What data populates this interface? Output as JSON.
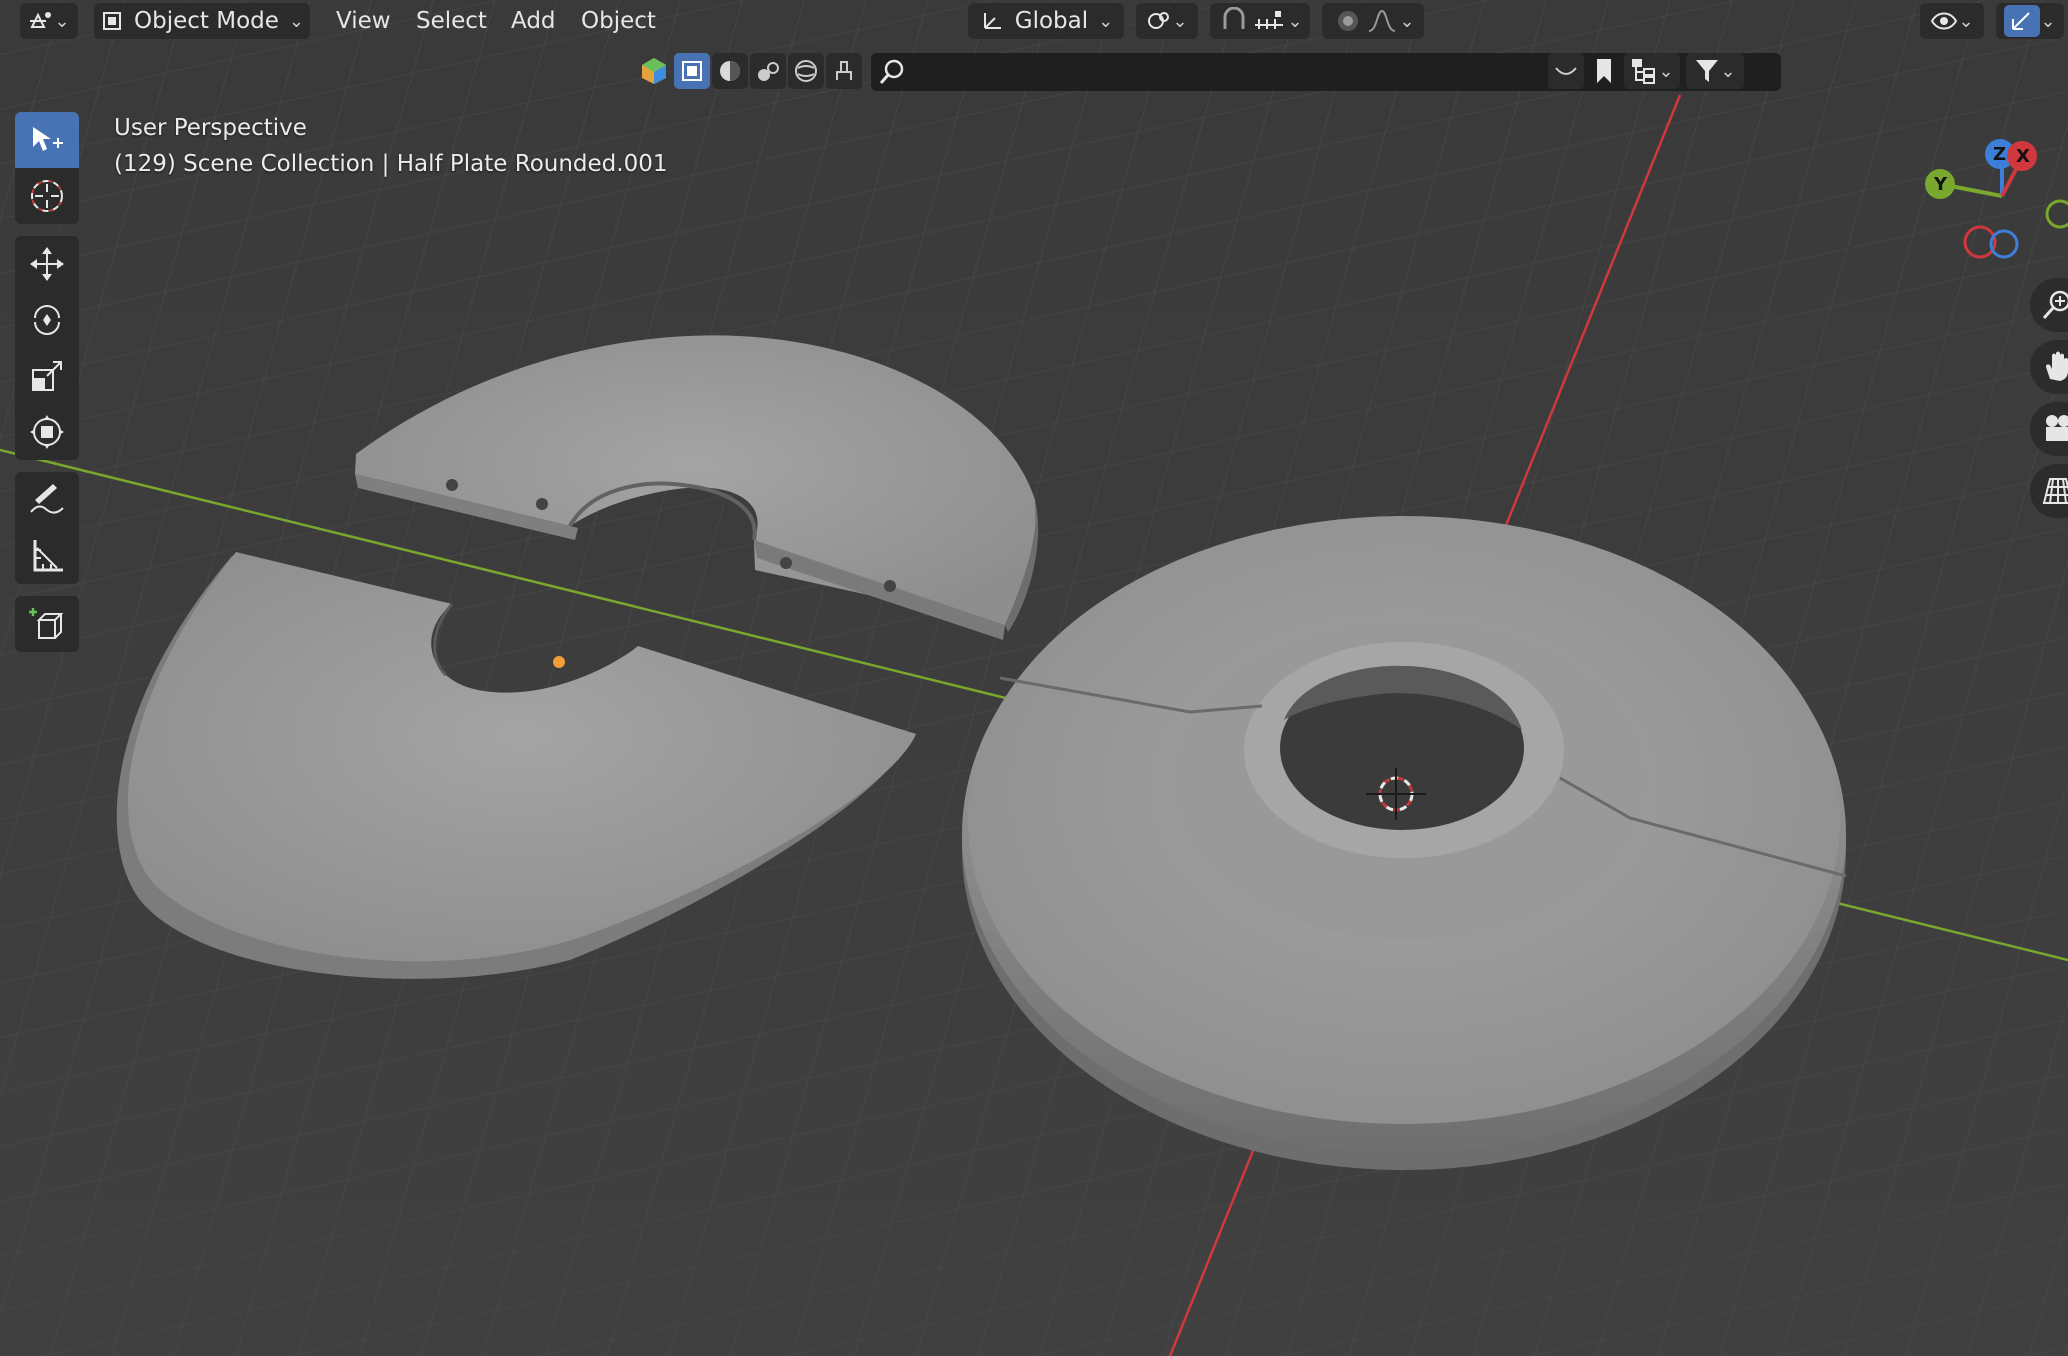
{
  "header": {
    "mode": "Object Mode",
    "menus": [
      "View",
      "Select",
      "Add",
      "Object"
    ],
    "orientation": "Global"
  },
  "viewport": {
    "view_name": "User Perspective",
    "collection_info": "(129) Scene Collection | Half Plate Rounded.001",
    "gizmo_axes": {
      "x": "X",
      "y": "Y",
      "z": "Z"
    }
  },
  "colors": {
    "accent": "#4772b3",
    "x_axis": "#d0383e",
    "y_axis": "#7aa72d",
    "z_axis": "#3c7ed8",
    "origin": "#f29d38",
    "background": "#3d3d3d"
  },
  "toolshelf_icons": [
    "select-box-icon",
    "cursor-icon",
    "move-icon",
    "rotate-icon",
    "scale-icon",
    "transform-icon",
    "annotate-icon",
    "measure-icon",
    "add-cube-icon"
  ],
  "nav_icons": [
    "zoom-icon",
    "pan-hand-icon",
    "camera-icon",
    "grid-perspective-icon"
  ]
}
